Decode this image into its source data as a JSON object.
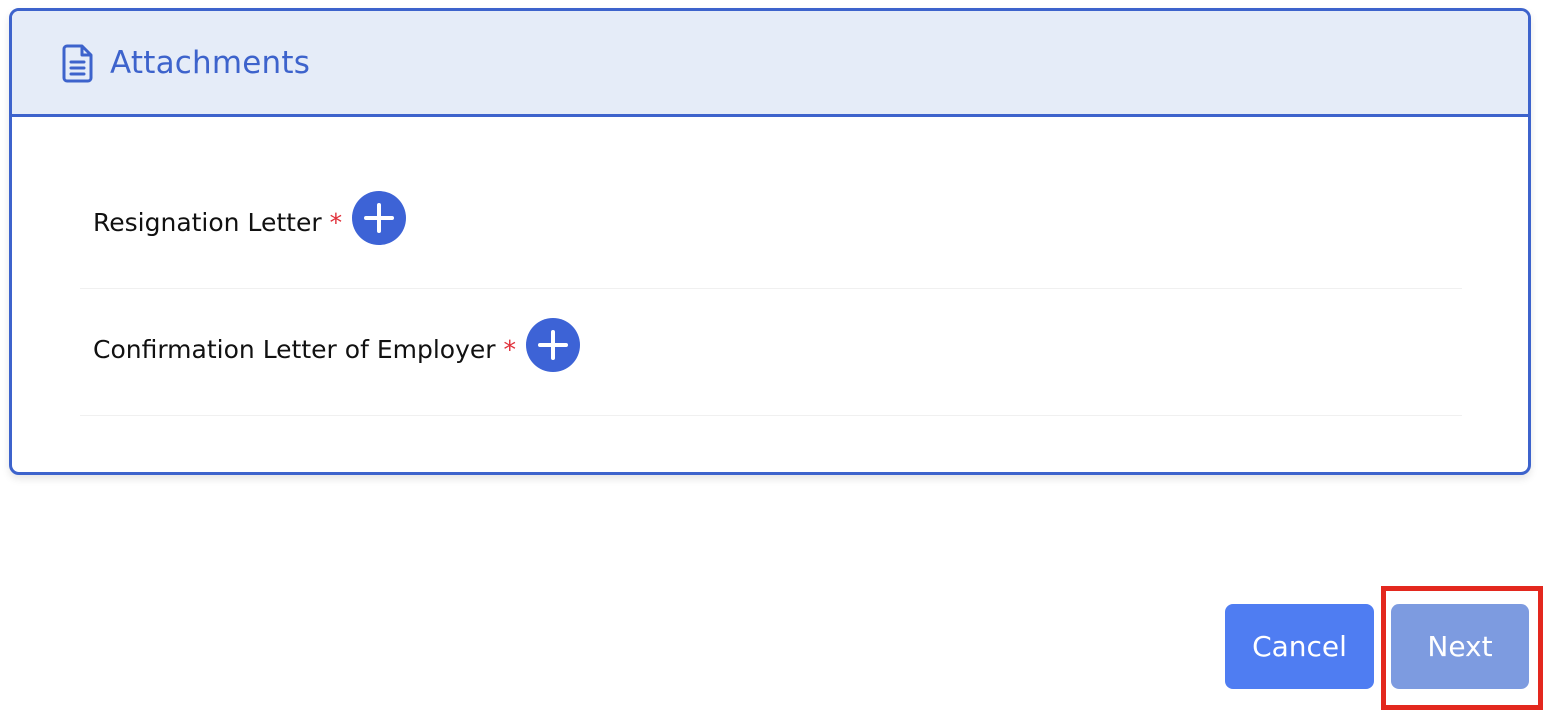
{
  "card": {
    "title": "Attachments",
    "icon": "document-icon",
    "accent_color": "#3d63cc"
  },
  "attachments": [
    {
      "label": "Resignation Letter",
      "required_marker": "*",
      "add_icon": "plus-icon"
    },
    {
      "label": "Confirmation Letter of Employer",
      "required_marker": "*",
      "add_icon": "plus-icon"
    }
  ],
  "actions": {
    "cancel_label": "Cancel",
    "next_label": "Next",
    "next_highlight_color": "#e3281e"
  }
}
